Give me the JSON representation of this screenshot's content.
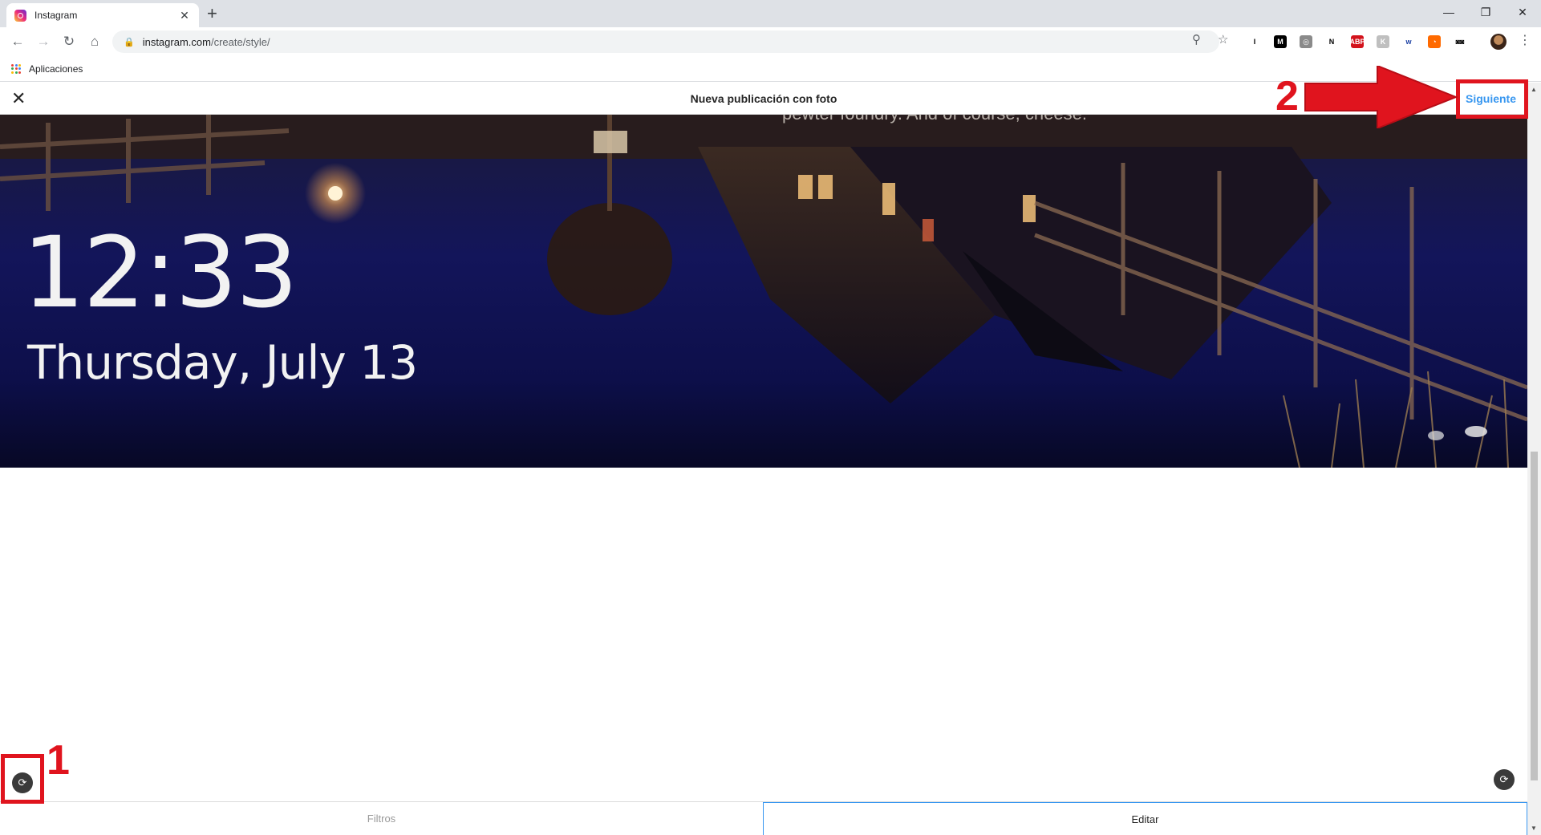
{
  "browser": {
    "tab_title": "Instagram",
    "tab_close": "✕",
    "new_tab": "+",
    "window_controls": {
      "minimize": "—",
      "maximize": "❐",
      "close": "✕"
    },
    "url_host": "instagram.com",
    "url_path": "/create/style/",
    "bookmarks": {
      "apps_label": "Aplicaciones"
    },
    "icons": {
      "back": "←",
      "forward": "→",
      "reload": "↻",
      "home": "⌂",
      "lock": "🔒",
      "zoom": "⚲",
      "star": "☆",
      "menu": "⋮"
    },
    "extensions": [
      {
        "name": "instapaper",
        "glyph": "I",
        "color": "#ffffff",
        "text": "#000000"
      },
      {
        "name": "medium",
        "glyph": "M",
        "color": "#000000",
        "text": "#ffffff"
      },
      {
        "name": "globe",
        "glyph": "◎",
        "color": "#8a8a8a",
        "text": "#ffffff"
      },
      {
        "name": "notion",
        "glyph": "N",
        "color": "#ffffff",
        "text": "#000000"
      },
      {
        "name": "adblock",
        "glyph": "ABP",
        "color": "#d3131c",
        "text": "#ffffff"
      },
      {
        "name": "k-ext",
        "glyph": "K",
        "color": "#bfbfbf",
        "text": "#ffffff"
      },
      {
        "name": "wp",
        "glyph": "w",
        "color": "#ffffff",
        "text": "#1a3fa3"
      },
      {
        "name": "feedly",
        "glyph": "◔",
        "color": "#ff6a00",
        "text": "#ffffff"
      },
      {
        "name": "glasses",
        "glyph": "◙◙",
        "color": "#ffffff",
        "text": "#000000"
      }
    ]
  },
  "instagram": {
    "header_title": "Nueva publicación con foto",
    "close_glyph": "✕",
    "next_label": "Siguiente",
    "photo": {
      "time": "12:33",
      "date": "Thursday, July 13",
      "caption": "pewter foundry. And of course, cheese."
    },
    "rotate_glyph": "⟳",
    "tabs": [
      {
        "label": "Filtros",
        "active": false
      },
      {
        "label": "Editar",
        "active": true
      }
    ]
  },
  "annotations": {
    "step1": "1",
    "step2": "2",
    "color": "#e0141e"
  },
  "scrollbar": {
    "up": "▲",
    "down": "▼"
  }
}
